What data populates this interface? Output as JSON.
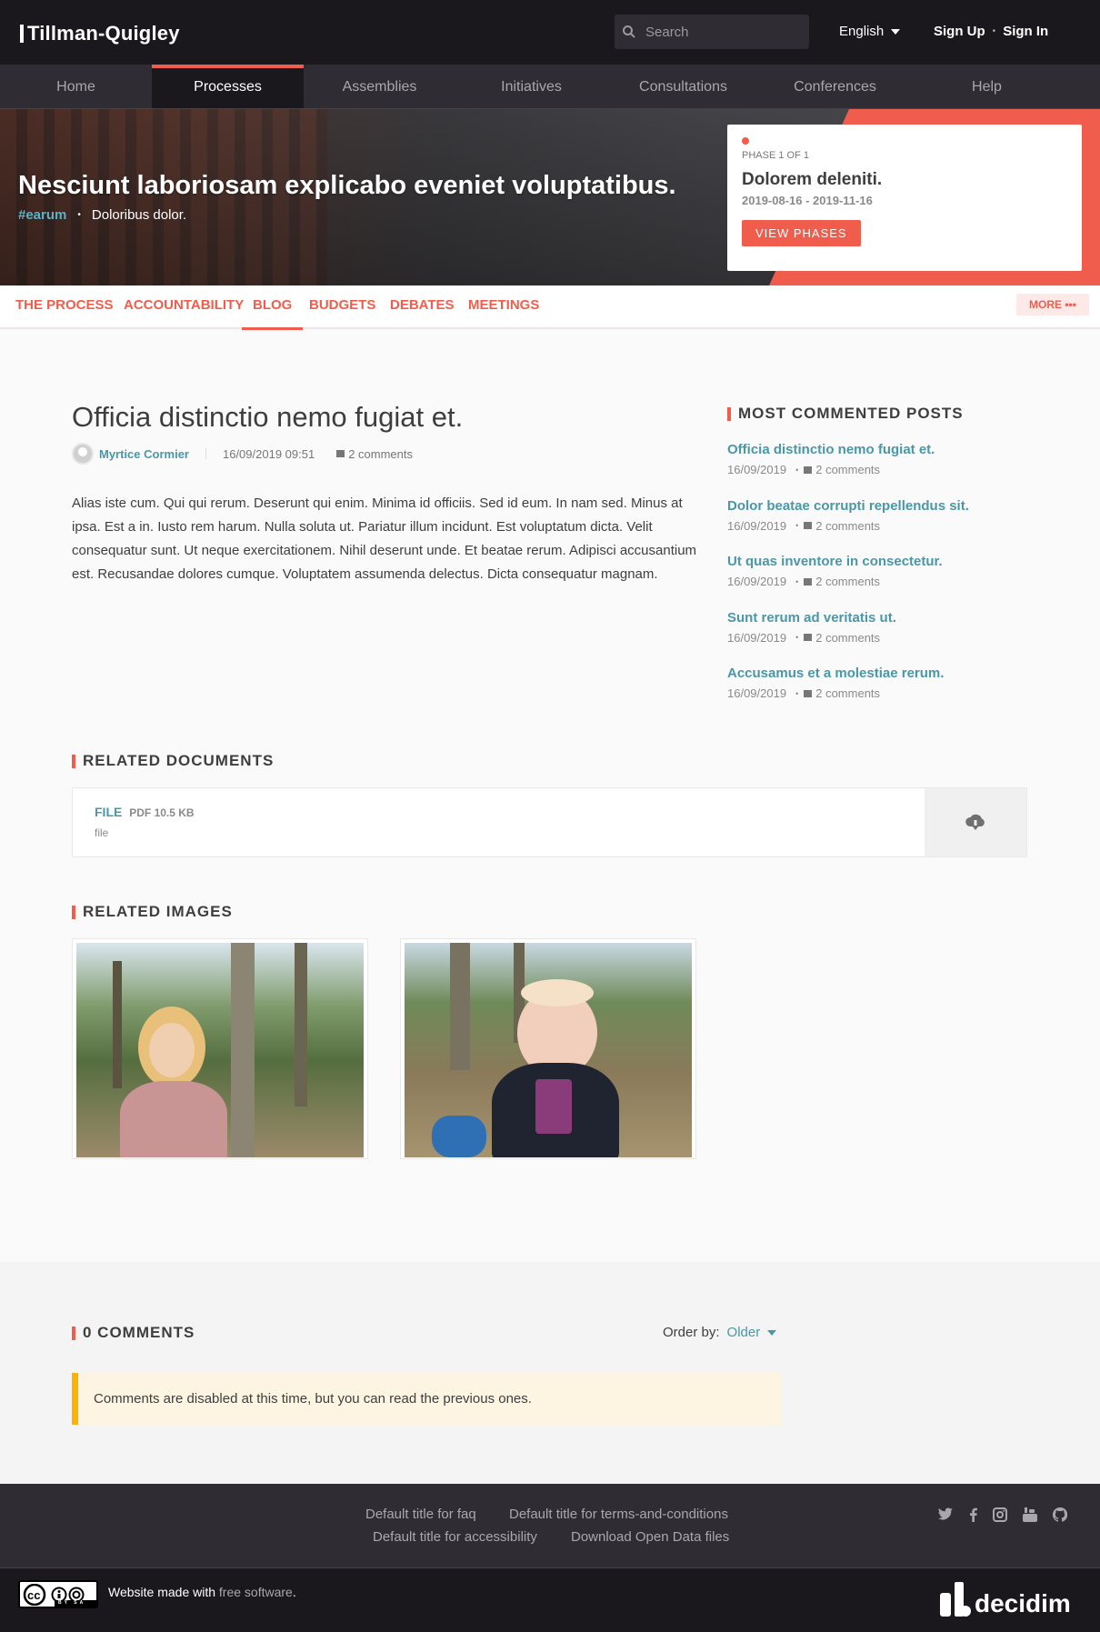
{
  "header": {
    "org_name": "Tillman-Quigley",
    "search_placeholder": "Search",
    "language": "English",
    "sign_up": "Sign Up",
    "sign_in": "Sign In"
  },
  "main_nav": [
    {
      "label": "Home"
    },
    {
      "label": "Processes",
      "active": true
    },
    {
      "label": "Assemblies"
    },
    {
      "label": "Initiatives"
    },
    {
      "label": "Consultations"
    },
    {
      "label": "Conferences"
    },
    {
      "label": "Help"
    }
  ],
  "hero": {
    "title": "Nesciunt laboriosam explicabo eveniet voluptatibus.",
    "hashtag": "#earum",
    "subtitle": "Doloribus dolor.",
    "phase_label": "PHASE 1 OF 1",
    "phase_title": "Dolorem deleniti.",
    "phase_dates": "2019-08-16 - 2019-11-16",
    "phase_button": "VIEW PHASES"
  },
  "process_tabs": [
    {
      "label": "THE PROCESS"
    },
    {
      "label": "ACCOUNTABILITY"
    },
    {
      "label": "BLOG",
      "active": true
    },
    {
      "label": "BUDGETS"
    },
    {
      "label": "DEBATES"
    },
    {
      "label": "MEETINGS"
    }
  ],
  "more_label": "MORE •••",
  "post": {
    "title": "Officia distinctio nemo fugiat et.",
    "author": "Myrtice Cormier",
    "datetime": "16/09/2019 09:51",
    "comments": "2 comments",
    "body": "Alias iste cum. Qui qui rerum. Deserunt qui enim. Minima id officiis. Sed id eum. In nam sed. Minus at ipsa. Est a in. Iusto rem harum. Nulla soluta ut. Pariatur illum incidunt. Est voluptatum dicta. Velit consequatur sunt. Ut neque exercitationem. Nihil deserunt unde. Et beatae rerum. Adipisci accusantium est. Recusandae dolores cumque. Voluptatem assumenda delectus. Dicta consequatur magnam."
  },
  "sidebar": {
    "heading": "MOST COMMENTED POSTS",
    "posts": [
      {
        "title": "Officia distinctio nemo fugiat et.",
        "date": "16/09/2019",
        "comments": "2 comments"
      },
      {
        "title": "Dolor beatae corrupti repellendus sit.",
        "date": "16/09/2019",
        "comments": "2 comments"
      },
      {
        "title": "Ut quas inventore in consectetur.",
        "date": "16/09/2019",
        "comments": "2 comments"
      },
      {
        "title": "Sunt rerum ad veritatis ut.",
        "date": "16/09/2019",
        "comments": "2 comments"
      },
      {
        "title": "Accusamus et a molestiae rerum.",
        "date": "16/09/2019",
        "comments": "2 comments"
      }
    ]
  },
  "documents": {
    "heading": "RELATED DOCUMENTS",
    "file_title": "FILE",
    "file_info": "PDF 10.5 KB",
    "file_desc": "file"
  },
  "images": {
    "heading": "RELATED IMAGES"
  },
  "comments": {
    "heading": "0 COMMENTS",
    "order_label": "Order by:",
    "order_value": "Older",
    "notice": "Comments are disabled at this time, but you can read the previous ones."
  },
  "footer": {
    "links": [
      {
        "label": "Default title for faq"
      },
      {
        "label": "Default title for terms-and-conditions"
      },
      {
        "label": "Default title for accessibility"
      },
      {
        "label": "Download Open Data files"
      }
    ],
    "social": [
      "twitter-icon",
      "facebook-icon",
      "instagram-icon",
      "youtube-icon",
      "github-icon"
    ],
    "made_with": "Website made with",
    "free_software": "free software",
    "period": ".",
    "brand": "decidim",
    "license": "BY SA"
  },
  "colors": {
    "primary": "#f15d4c",
    "secondary": "#4a97a8",
    "dark": "#1a181d",
    "warning": "#ffb300"
  }
}
